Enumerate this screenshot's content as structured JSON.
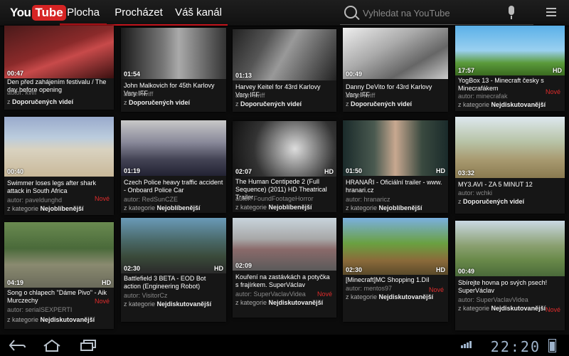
{
  "app": {
    "logo_you": "You",
    "logo_tube": "Tube"
  },
  "tabs": [
    {
      "label": "Plocha"
    },
    {
      "label": "Procházet"
    },
    {
      "label": "Váš kanál"
    }
  ],
  "search": {
    "placeholder": "Vyhledat na YouTube"
  },
  "status": {
    "time": "22:20"
  },
  "videos": [
    {
      "duration": "00:47",
      "hd": "",
      "title": "Den před zahájením festivalu / The day before opening",
      "author": "autor: kviff",
      "category_prefix": "z",
      "category": "Doporučených videí",
      "badge": ""
    },
    {
      "duration": "01:54",
      "hd": "",
      "title": "John Malkovich for 45th Karlovy Vary IFF",
      "author": "autor: kviff",
      "category_prefix": "z",
      "category": "Doporučených videí",
      "badge": ""
    },
    {
      "duration": "01:13",
      "hd": "",
      "title": "Harvey Keitel for 43rd Karlovy Vary IFF",
      "author": "autor: kviff",
      "category_prefix": "z",
      "category": "Doporučených videí",
      "badge": ""
    },
    {
      "duration": "00:49",
      "hd": "",
      "title": "Danny DeVito for 43rd Karlovy Vary IFF",
      "author": "autor: kviff",
      "category_prefix": "z",
      "category": "Doporučených videí",
      "badge": ""
    },
    {
      "duration": "17:57",
      "hd": "HD",
      "title": "YogBox 13 - Minecraft česky s Minecrafákem",
      "author": "autor: minecrafak",
      "category_prefix": "z kategorie",
      "category": "Nejdiskutovanější",
      "badge": "Nové"
    },
    {
      "duration": "00:40",
      "hd": "",
      "title": "Swimmer loses legs after shark attack in South Africa",
      "author": "autor: paveldunghd",
      "category_prefix": "z kategorie",
      "category": "Nejoblíbenější",
      "badge": "Nové"
    },
    {
      "duration": "01:19",
      "hd": "",
      "title": "Czech Police heavy traffic accident - Onboard Police Car",
      "author": "autor: RedSunCZE",
      "category_prefix": "z kategorie",
      "category": "Nejoblíbenější",
      "badge": ""
    },
    {
      "duration": "02:07",
      "hd": "HD",
      "title": "The Human Centipede 2 (Full Sequence) (2011) HD Theatrical Trailer",
      "author": "autor: FoundFootageHorror",
      "category_prefix": "z kategorie",
      "category": "Nejoblíbenější",
      "badge": ""
    },
    {
      "duration": "01:50",
      "hd": "HD",
      "title": "HRANAŘI - Oficiální trailer - www. hranari.cz",
      "author": "autor: hranaricz",
      "category_prefix": "z kategorie",
      "category": "Nejoblíbenější",
      "badge": ""
    },
    {
      "duration": "03:32",
      "hd": "",
      "title": "MY3.AVI - ZA 5 MINUT 12",
      "author": "autor: wchki",
      "category_prefix": "z",
      "category": "Doporučených videí",
      "badge": ""
    },
    {
      "duration": "04:19",
      "hd": "HD",
      "title": "Song o chlapech \"Dáme Pivo\" - Aik Murczechy",
      "author": "autor: serialSEXPERTI",
      "category_prefix": "z kategorie",
      "category": "Nejdiskutovanější",
      "badge": "Nové"
    },
    {
      "duration": "02:30",
      "hd": "HD",
      "title": "Battlefield 3 BETA - EOD Bot action (Engineering Robot)",
      "author": "autor: VisitorCz",
      "category_prefix": "z kategorie",
      "category": "Nejdiskutovanější",
      "badge": ""
    },
    {
      "duration": "02:09",
      "hd": "",
      "title": "Kouření na zastávkách a potyčka s frajírkem. SuperVáclav",
      "author": "autor: SuperVaclavVidea",
      "category_prefix": "z kategorie",
      "category": "Nejdiskutovanější",
      "badge": "Nové"
    },
    {
      "duration": "02:30",
      "hd": "HD",
      "title": "[Minecraft]MC Shopping 1.Díl",
      "author": "autor: mentos97",
      "category_prefix": "z kategorie",
      "category": "Nejdiskutovanější",
      "badge": "Nové"
    },
    {
      "duration": "00:49",
      "hd": "",
      "title": "Sbírejte hovna po svých psech! SuperVáclav",
      "author": "autor: SuperVaclavVidea",
      "category_prefix": "z kategorie",
      "category": "Nejdiskutovanější",
      "badge": "Nové"
    }
  ],
  "colors": {
    "accent": "#c8161d",
    "badge": "#e02c2c",
    "system": "#9fb4cc"
  },
  "icons": {
    "search": "search-icon",
    "mic": "microphone-icon",
    "menu": "menu-icon",
    "back": "back-icon",
    "home": "home-icon",
    "recent": "recent-apps-icon"
  }
}
